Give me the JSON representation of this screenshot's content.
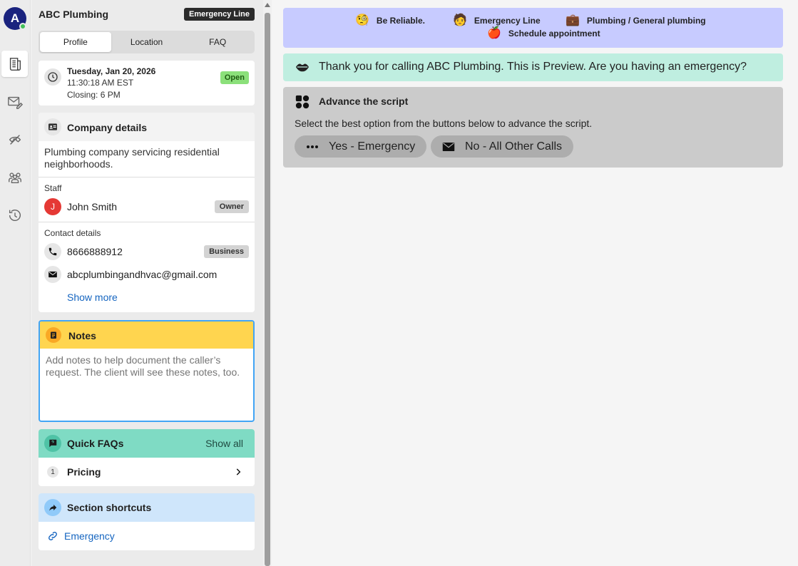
{
  "rail": {
    "avatar_letter": "A",
    "items": [
      {
        "icon": "script-icon"
      },
      {
        "icon": "mail-edit-icon"
      },
      {
        "icon": "no-call-icon"
      },
      {
        "icon": "team-icon"
      },
      {
        "icon": "history-icon"
      }
    ]
  },
  "panel": {
    "company_name": "ABC Plumbing",
    "emergency_tag": "Emergency Line",
    "tabs": [
      "Profile",
      "Location",
      "FAQ"
    ],
    "active_tab": "Profile",
    "time": {
      "date": "Tuesday, Jan 20, 2026",
      "clock": "11:30:18 AM EST",
      "closing": "Closing: 6 PM",
      "status": "Open"
    },
    "company": {
      "title": "Company details",
      "description": "Plumbing company servicing residential neighborhoods.",
      "staff_label": "Staff",
      "staff_initial": "J",
      "staff_name": "John Smith",
      "staff_role": "Owner",
      "contact_label": "Contact details",
      "phone": "8666888912",
      "phone_type": "Business",
      "email": "abcplumbingandhvac@gmail.com",
      "show_more": "Show more"
    },
    "notes": {
      "title": "Notes",
      "placeholder": "Add notes to help document the caller’s request. The client will see these notes, too."
    },
    "faqs": {
      "title": "Quick FAQs",
      "show_all": "Show all",
      "items": [
        {
          "num": "1",
          "label": "Pricing"
        }
      ]
    },
    "shortcuts": {
      "title": "Section shortcuts",
      "items": [
        {
          "label": "Emergency"
        }
      ]
    }
  },
  "main": {
    "banner": {
      "reliable": "Be Reliable.",
      "emergency_line": "Emergency Line",
      "category": "Plumbing / General plumbing",
      "appointment": "Schedule appointment"
    },
    "greeting": "Thank you for calling ABC Plumbing. This is Preview. Are you having an emergency?",
    "script": {
      "title": "Advance the script",
      "instruction": "Select the best option from the buttons below to advance the script.",
      "options": [
        "Yes - Emergency",
        "No - All Other Calls"
      ]
    }
  },
  "colors": {
    "banner_bg": "#c7cbff",
    "greeting_bg": "#bfeee0",
    "notes_header": "#ffd54f",
    "faq_header": "#7fdbc4",
    "shortcut_header": "#cfe6fb",
    "open_badge": "#8be07a",
    "link": "#1565c0"
  }
}
